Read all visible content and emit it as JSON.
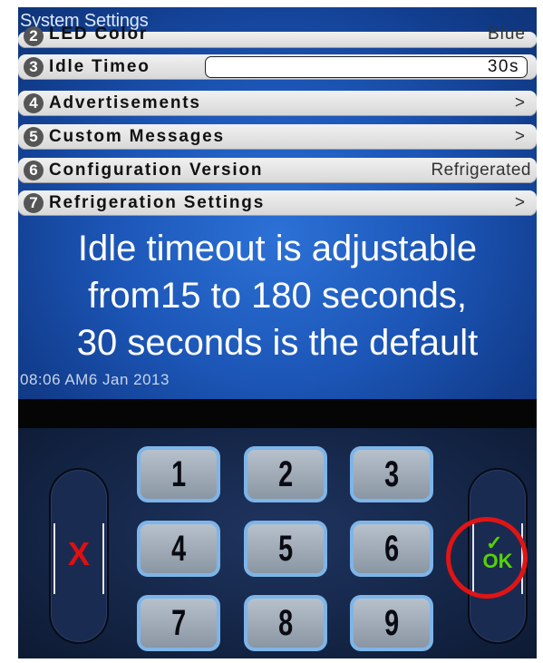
{
  "screen": {
    "title": "System Settings",
    "rows": [
      {
        "num": "2",
        "label": "LED Color",
        "value": "Blue"
      },
      {
        "num": "3",
        "label": "Idle Timeo",
        "value": "30s"
      },
      {
        "num": "4",
        "label": "Advertisements",
        "value": ">"
      },
      {
        "num": "5",
        "label": "Custom Messages",
        "value": ">"
      },
      {
        "num": "6",
        "label": "Configuration Version",
        "value": "Refrigerated"
      },
      {
        "num": "7",
        "label": "Refrigeration Settings",
        "value": ">"
      }
    ],
    "message_lines": [
      "Idle timeout is adjustable",
      "from15 to 180 seconds,",
      "30 seconds is the default"
    ],
    "clock": "08:06 AM6 Jan 2013"
  },
  "keypad": {
    "keys": [
      "1",
      "2",
      "3",
      "4",
      "5",
      "6",
      "7",
      "8",
      "9"
    ],
    "cancel_symbol": "X",
    "ok_check": "✓",
    "ok_label": "OK"
  },
  "colors": {
    "screen_blue": "#1c56b7",
    "cancel_red": "#e01010",
    "ok_green": "#55d400",
    "highlight_ring": "#e01414"
  }
}
